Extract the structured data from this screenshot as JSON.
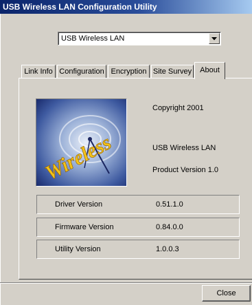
{
  "window": {
    "title": "USB Wireless LAN Configuration Utility"
  },
  "adapter_select": {
    "value": "USB Wireless LAN"
  },
  "tabs": [
    {
      "label": "Link Info"
    },
    {
      "label": "Configuration"
    },
    {
      "label": "Encryption"
    },
    {
      "label": "Site Survey"
    },
    {
      "label": "About"
    }
  ],
  "active_tab": "About",
  "about": {
    "logo_text": "Wireless",
    "copyright": "Copyright 2001",
    "product_name": "USB Wireless LAN",
    "product_version": "Product Version 1.0",
    "versions": [
      {
        "label": "Driver Version",
        "value": "0.51.1.0"
      },
      {
        "label": "Firmware Version",
        "value": "0.84.0.0"
      },
      {
        "label": "Utility Version",
        "value": "1.0.0.3"
      }
    ]
  },
  "buttons": {
    "close": "Close"
  },
  "colors": {
    "face": "#d4d0c8",
    "titlebar_start": "#0a246a",
    "titlebar_end": "#a6caf0",
    "logo_text": "#f2c21a"
  }
}
